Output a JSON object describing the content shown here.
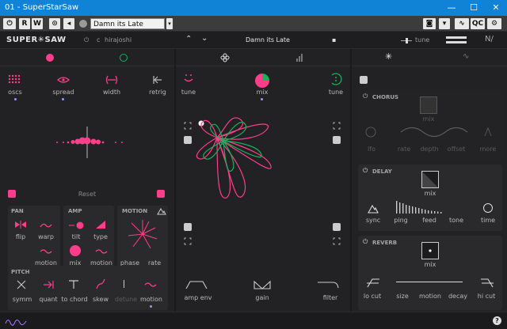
{
  "window": {
    "title": "01 - SuperStarSaw"
  },
  "host": {
    "power_label": "⏻",
    "r_label": "R",
    "w_label": "W",
    "preset_name": "Damn its Late",
    "qc_label": "QC"
  },
  "header": {
    "brand": "SUPER✳SAW",
    "author_prefix": "c",
    "author": "hirajoshi",
    "preset_name": "Damn its Late",
    "tune_label": "tune"
  },
  "left": {
    "osc_labels": [
      "oscs",
      "spread",
      "width",
      "retrig"
    ],
    "reset_label": "Reset",
    "pan": {
      "title": "PAN",
      "flip": "flip",
      "warp": "warp",
      "motion": "motion"
    },
    "amp": {
      "title": "AMP",
      "tilt": "tilt",
      "type": "type",
      "mix": "mix",
      "motion": "motion"
    },
    "motion": {
      "title": "MOTION",
      "phase": "phase",
      "rate": "rate"
    },
    "pitch": {
      "title": "PITCH",
      "items": [
        "symm",
        "quant",
        "to chord",
        "skew",
        "detune",
        "motion"
      ]
    }
  },
  "middle": {
    "tune_left": "tune",
    "mix": "mix",
    "tune_right": "tune",
    "bottom": [
      "amp env",
      "gain",
      "filter"
    ]
  },
  "right": {
    "chorus": {
      "title": "CHORUS",
      "mix": "mix",
      "labels": [
        "lfo",
        "rate",
        "depth",
        "offset",
        "more"
      ]
    },
    "delay": {
      "title": "DELAY",
      "mix": "mix",
      "labels": [
        "sync",
        "ping",
        "feed",
        "tone",
        "time"
      ]
    },
    "reverb": {
      "title": "REVERB",
      "mix": "mix",
      "labels": [
        "lo cut",
        "size",
        "motion",
        "decay",
        "hi cut"
      ]
    }
  },
  "footer": {
    "signature": "hirajoshi",
    "help": "?"
  },
  "colors": {
    "accent_pink": "#ff3d8b",
    "accent_green": "#19b05a",
    "accent_blue": "#8e9bff",
    "titlebar": "#1083d6"
  }
}
